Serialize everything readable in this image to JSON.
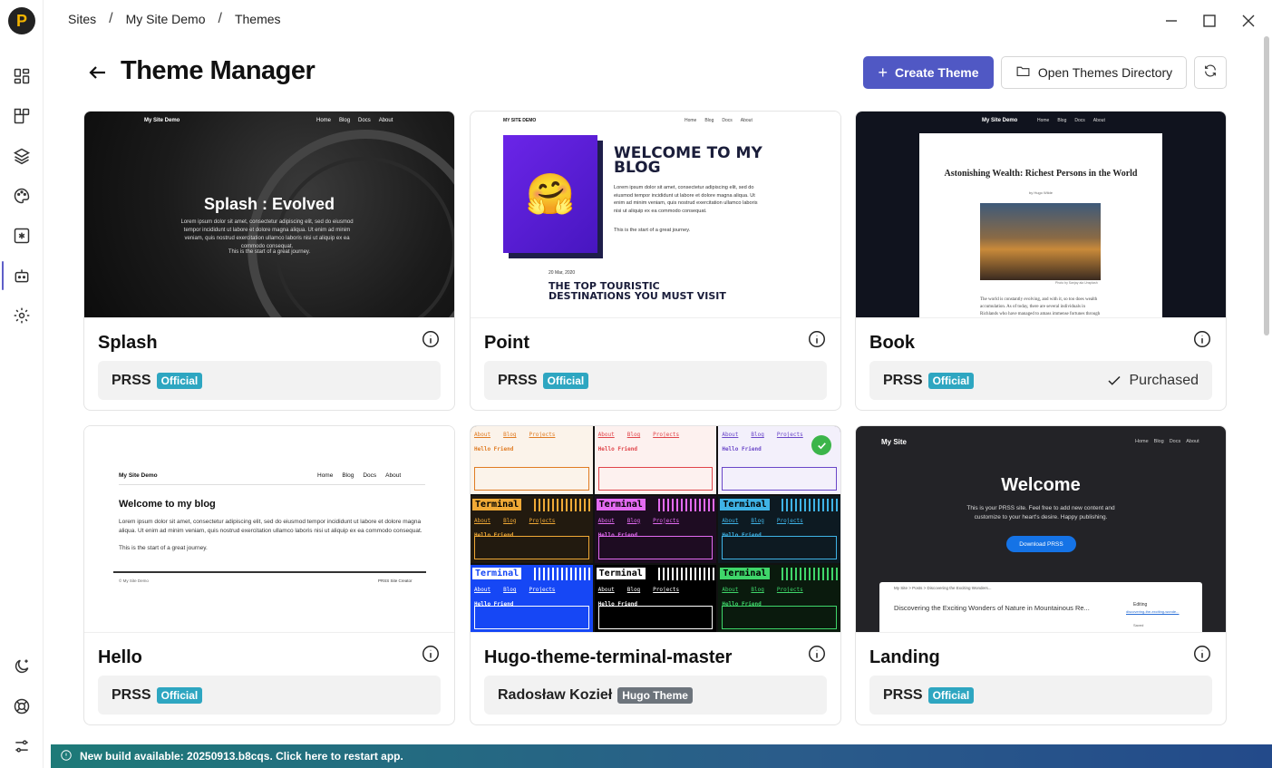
{
  "breadcrumb": {
    "items": [
      "Sites",
      "My Site Demo",
      "Themes"
    ],
    "sep": "/"
  },
  "header": {
    "title": "Theme Manager",
    "create_label": "Create Theme",
    "open_dir_label": "Open Themes Directory"
  },
  "themes": [
    {
      "name": "Splash",
      "author": "PRSS",
      "badge": "Official",
      "purchased": "",
      "preview": {
        "site": "My Site Demo",
        "nav": [
          "Home",
          "Blog",
          "Docs",
          "About"
        ],
        "heading": "Splash : Evolved",
        "body": "Lorem ipsum dolor sit amet, consectetur adipiscing elit, sed do eiusmod tempor incididunt ut labore et dolore magna aliqua. Ut enim ad minim veniam, quis nostrud exercitation ullamco laboris nisi ut aliquip ex ea commodo consequat.",
        "tagline": "This is the start of a great journey."
      }
    },
    {
      "name": "Point",
      "author": "PRSS",
      "badge": "Official",
      "purchased": "",
      "preview": {
        "site": "MY SITE DEMO",
        "nav": [
          "Home",
          "Blog",
          "Docs",
          "About"
        ],
        "heading": "WELCOME TO MY BLOG",
        "body": "Lorem ipsum dolor sit amet, consectetur adipiscing elit, sed do eiusmod tempor incididunt ut labore et dolore magna aliqua. Ut enim ad minim veniam, quis nostrud exercitation ullamco laboris nisi ut aliquip ex ea commodo consequat.",
        "tagline": "This is the start of a great journey.",
        "date": "20 Mar, 2020",
        "post": "THE TOP TOURISTIC DESTINATIONS YOU MUST VISIT",
        "emoji": "🤗"
      }
    },
    {
      "name": "Book",
      "author": "PRSS",
      "badge": "Official",
      "purchased": "Purchased",
      "preview": {
        "site": "My Site Demo",
        "nav": [
          "Home",
          "Blog",
          "Docs",
          "About"
        ],
        "heading": "Astonishing Wealth: Richest Persons in the World",
        "byline": "by Hugo Wilde",
        "caption": "Photo by Sanjay ala Unsplash",
        "body": "The world is constantly evolving, and with it, so too does wealth accumulation. As of today, there are several individuals in Richlands who have managed to amass immense fortunes through various"
      }
    },
    {
      "name": "Hello",
      "author": "PRSS",
      "badge": "Official",
      "purchased": "",
      "preview": {
        "site": "My Site Demo",
        "nav": [
          "Home",
          "Blog",
          "Docs",
          "About"
        ],
        "heading": "Welcome to my blog",
        "body": "Lorem ipsum dolor sit amet, consectetur adipiscing elit, sed do eiusmod tempor incididunt ut labore et dolore magna aliqua. Ut enim ad minim veniam, quis nostrud exercitation ullamco laboris nisi ut aliquip ex ea commodo consequat.",
        "tagline": "This is the start of a great journey.",
        "footer": "© My Site Demo",
        "credit": "PRSS Site Creator"
      }
    },
    {
      "name": "Hugo-theme-terminal-master",
      "author": "Radosław Kozieł",
      "badge": "Hugo Theme",
      "purchased": "",
      "preview": {
        "links": [
          "About",
          "Blog",
          "Projects"
        ],
        "hello": "Hello Friend",
        "label": "Terminal"
      }
    },
    {
      "name": "Landing",
      "author": "PRSS",
      "badge": "Official",
      "purchased": "",
      "preview": {
        "site": "My Site",
        "nav": [
          "Home",
          "Blog",
          "Docs",
          "About"
        ],
        "heading": "Welcome",
        "body": "This is your PRSS site. Feel free to add new content and customize to your heart's desire. Happy publishing.",
        "button": "Download PRSS",
        "shot_crumb": "My Site  >  Posts  >  Discovering the Exciting Wonders...",
        "shot_title": "Discovering the Exciting Wonders of Nature in Mountainous Re...",
        "shot_side": "Editing",
        "shot_link": "discovering-the-exciting-wonde...",
        "shot_saved": "Saved"
      }
    }
  ],
  "banner": {
    "text": "New build available: 20250913.b8cqs. Click here to restart app."
  },
  "colors": {
    "accent": "#5058c4",
    "badge": "#2ea6c1",
    "banner": "#1e7a78"
  }
}
